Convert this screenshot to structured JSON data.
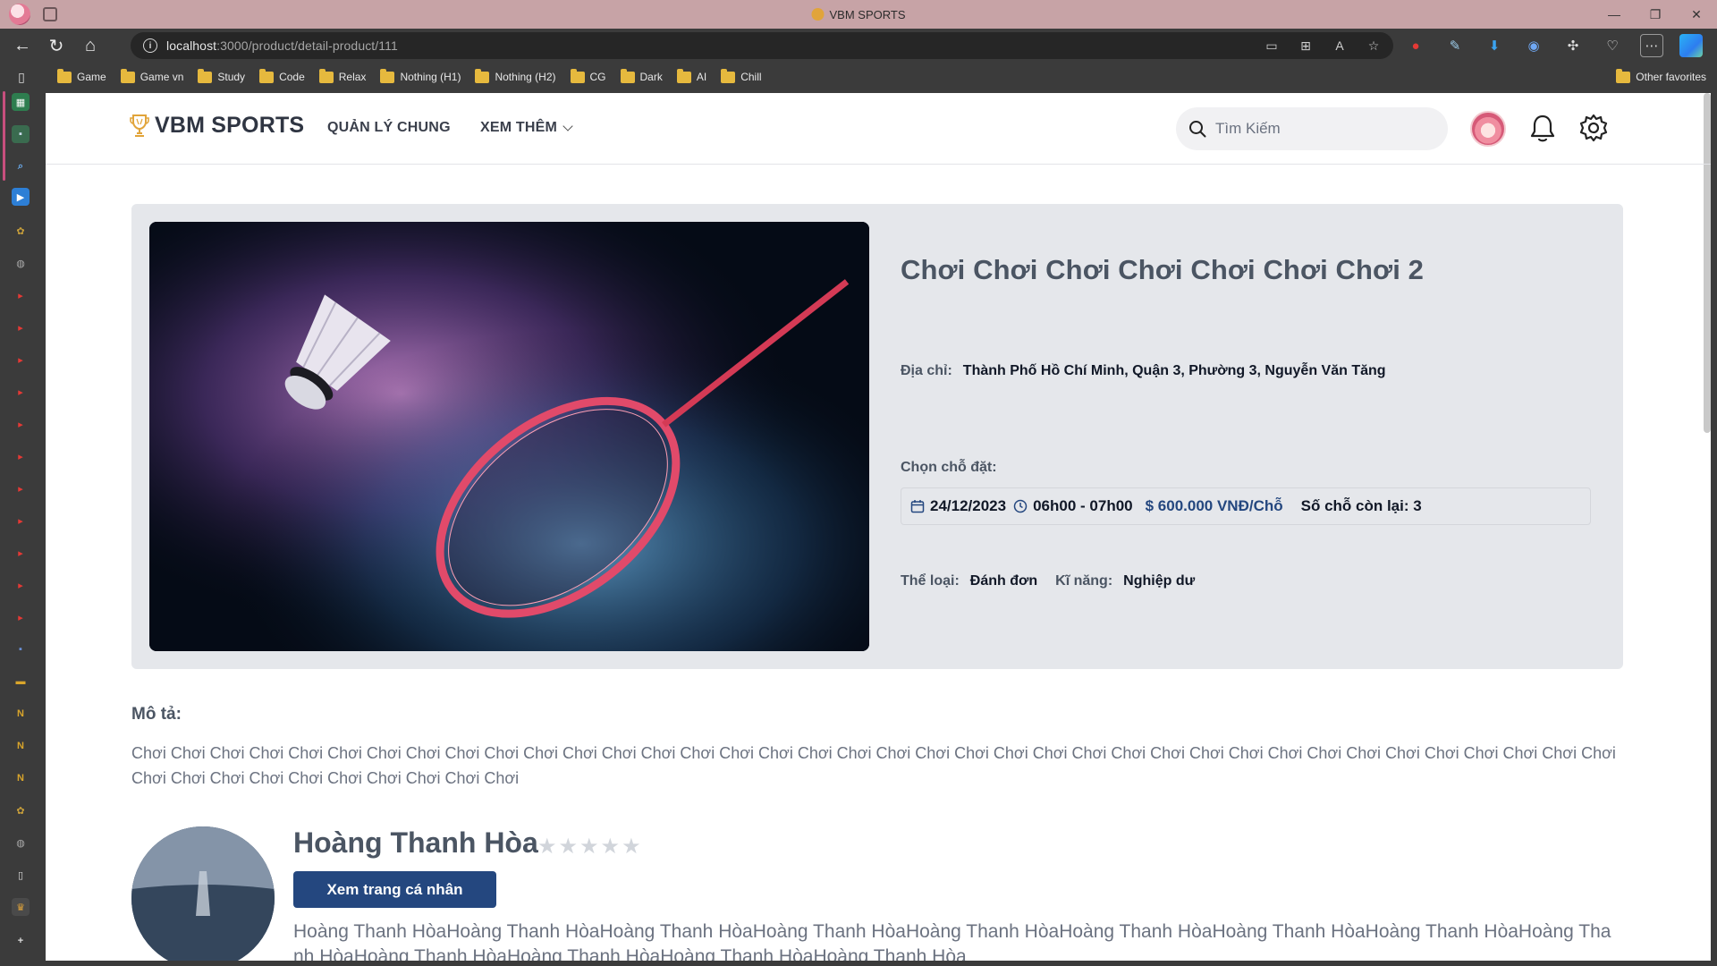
{
  "browser": {
    "tab_title": "VBM SPORTS",
    "url_host": "localhost",
    "url_path": ":3000/product/detail-product/111",
    "bookmarks": [
      "Game",
      "Game vn",
      "Study",
      "Code",
      "Relax",
      "Nothing (H1)",
      "Nothing (H2)",
      "CG",
      "Dark",
      "AI",
      "Chill"
    ],
    "other_favorites": "Other favorites"
  },
  "header": {
    "brand": "VBM SPORTS",
    "menu_general": "QUẢN LÝ CHUNG",
    "menu_more": "XEM THÊM",
    "search_placeholder": "Tìm Kiếm"
  },
  "product": {
    "title": "Chơi Chơi Chơi Chơi Chơi Chơi Chơi 2",
    "address_label": "Địa chỉ:",
    "address": "Thành Phố Hồ Chí Minh, Quận 3, Phường 3, Nguyễn Văn Tăng",
    "slot_label": "Chọn chỗ đặt:",
    "slot": {
      "date": "24/12/2023",
      "time": "06h00 - 07h00",
      "price": "$ 600.000 VNĐ/Chỗ",
      "remaining": "Số chỗ còn lại: 3"
    },
    "category_label": "Thể loại:",
    "category": "Đánh đơn",
    "skill_label": "Kĩ năng:",
    "skill": "Nghiệp dư"
  },
  "description": {
    "label": "Mô tả:",
    "text": "Chơi Chơi Chơi Chơi Chơi Chơi Chơi Chơi Chơi Chơi Chơi Chơi Chơi Chơi Chơi Chơi Chơi Chơi Chơi Chơi Chơi Chơi Chơi Chơi Chơi Chơi Chơi Chơi Chơi Chơi Chơi Chơi Chơi Chơi Chơi Chơi Chơi Chơi Chơi Chơi Chơi Chơi Chơi Chơi Chơi Chơi Chơi Chơi"
  },
  "owner": {
    "name": "Hoàng Thanh Hòa",
    "stars": "★★★★★",
    "rating": 0,
    "profile_button": "Xem trang cá nhân",
    "bio": "Hoàng Thanh HòaHoàng Thanh HòaHoàng Thanh HòaHoàng Thanh HòaHoàng Thanh HòaHoàng Thanh HòaHoàng Thanh HòaHoàng Thanh HòaHoàng Thanh HòaHoàng Thanh HòaHoàng Thanh HòaHoàng Thanh HòaHoàng Thanh Hòa"
  },
  "colors": {
    "primary": "#24477f",
    "hero_bg": "#e5e7eb",
    "titlebar": "#c7a3a6"
  }
}
